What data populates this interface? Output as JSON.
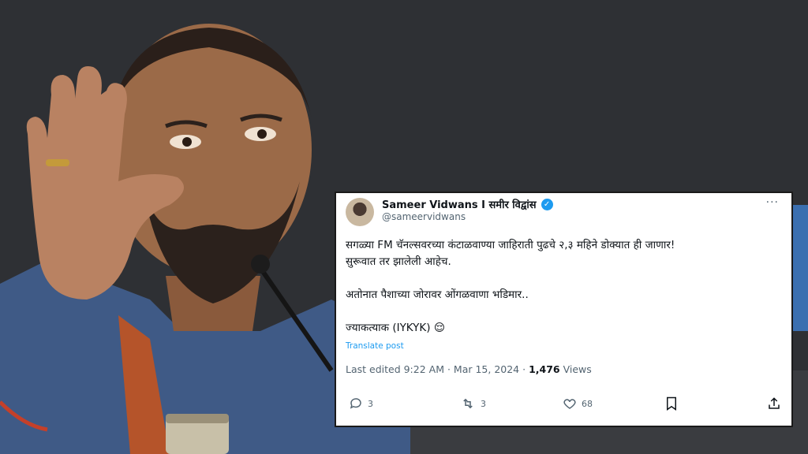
{
  "tweet": {
    "display_name": "Sameer Vidwans I समीर विद्वांस",
    "handle": "@sameervidwans",
    "more": "···",
    "line1": "सगळ्या FM चॅनल्सवरच्या कंटाळवाण्या जाहिराती पुढचे २,३ महिने डोक्यात ही जाणार!",
    "line2": "सुरूवात तर झालेली आहेच.",
    "line3": "अतोनात पैशाच्या जोरावर ओंगळवाणा भडिमार..",
    "line4": "ज्याकत्याक (IYKYK) 😌",
    "translate": "Translate post",
    "meta_prefix": "Last edited 9:22 AM · Mar 15, 2024 · ",
    "views_count": "1,476",
    "views_label": " Views",
    "replies": "3",
    "reposts": "3",
    "likes": "68"
  },
  "icons": {
    "reply": "reply-icon",
    "repost": "repost-icon",
    "like": "heart-icon",
    "bookmark": "bookmark-icon",
    "share": "share-icon",
    "verified": "verified-badge-icon"
  },
  "colors": {
    "link": "#1d9bf0",
    "muted": "#536471",
    "text": "#0f1419"
  }
}
